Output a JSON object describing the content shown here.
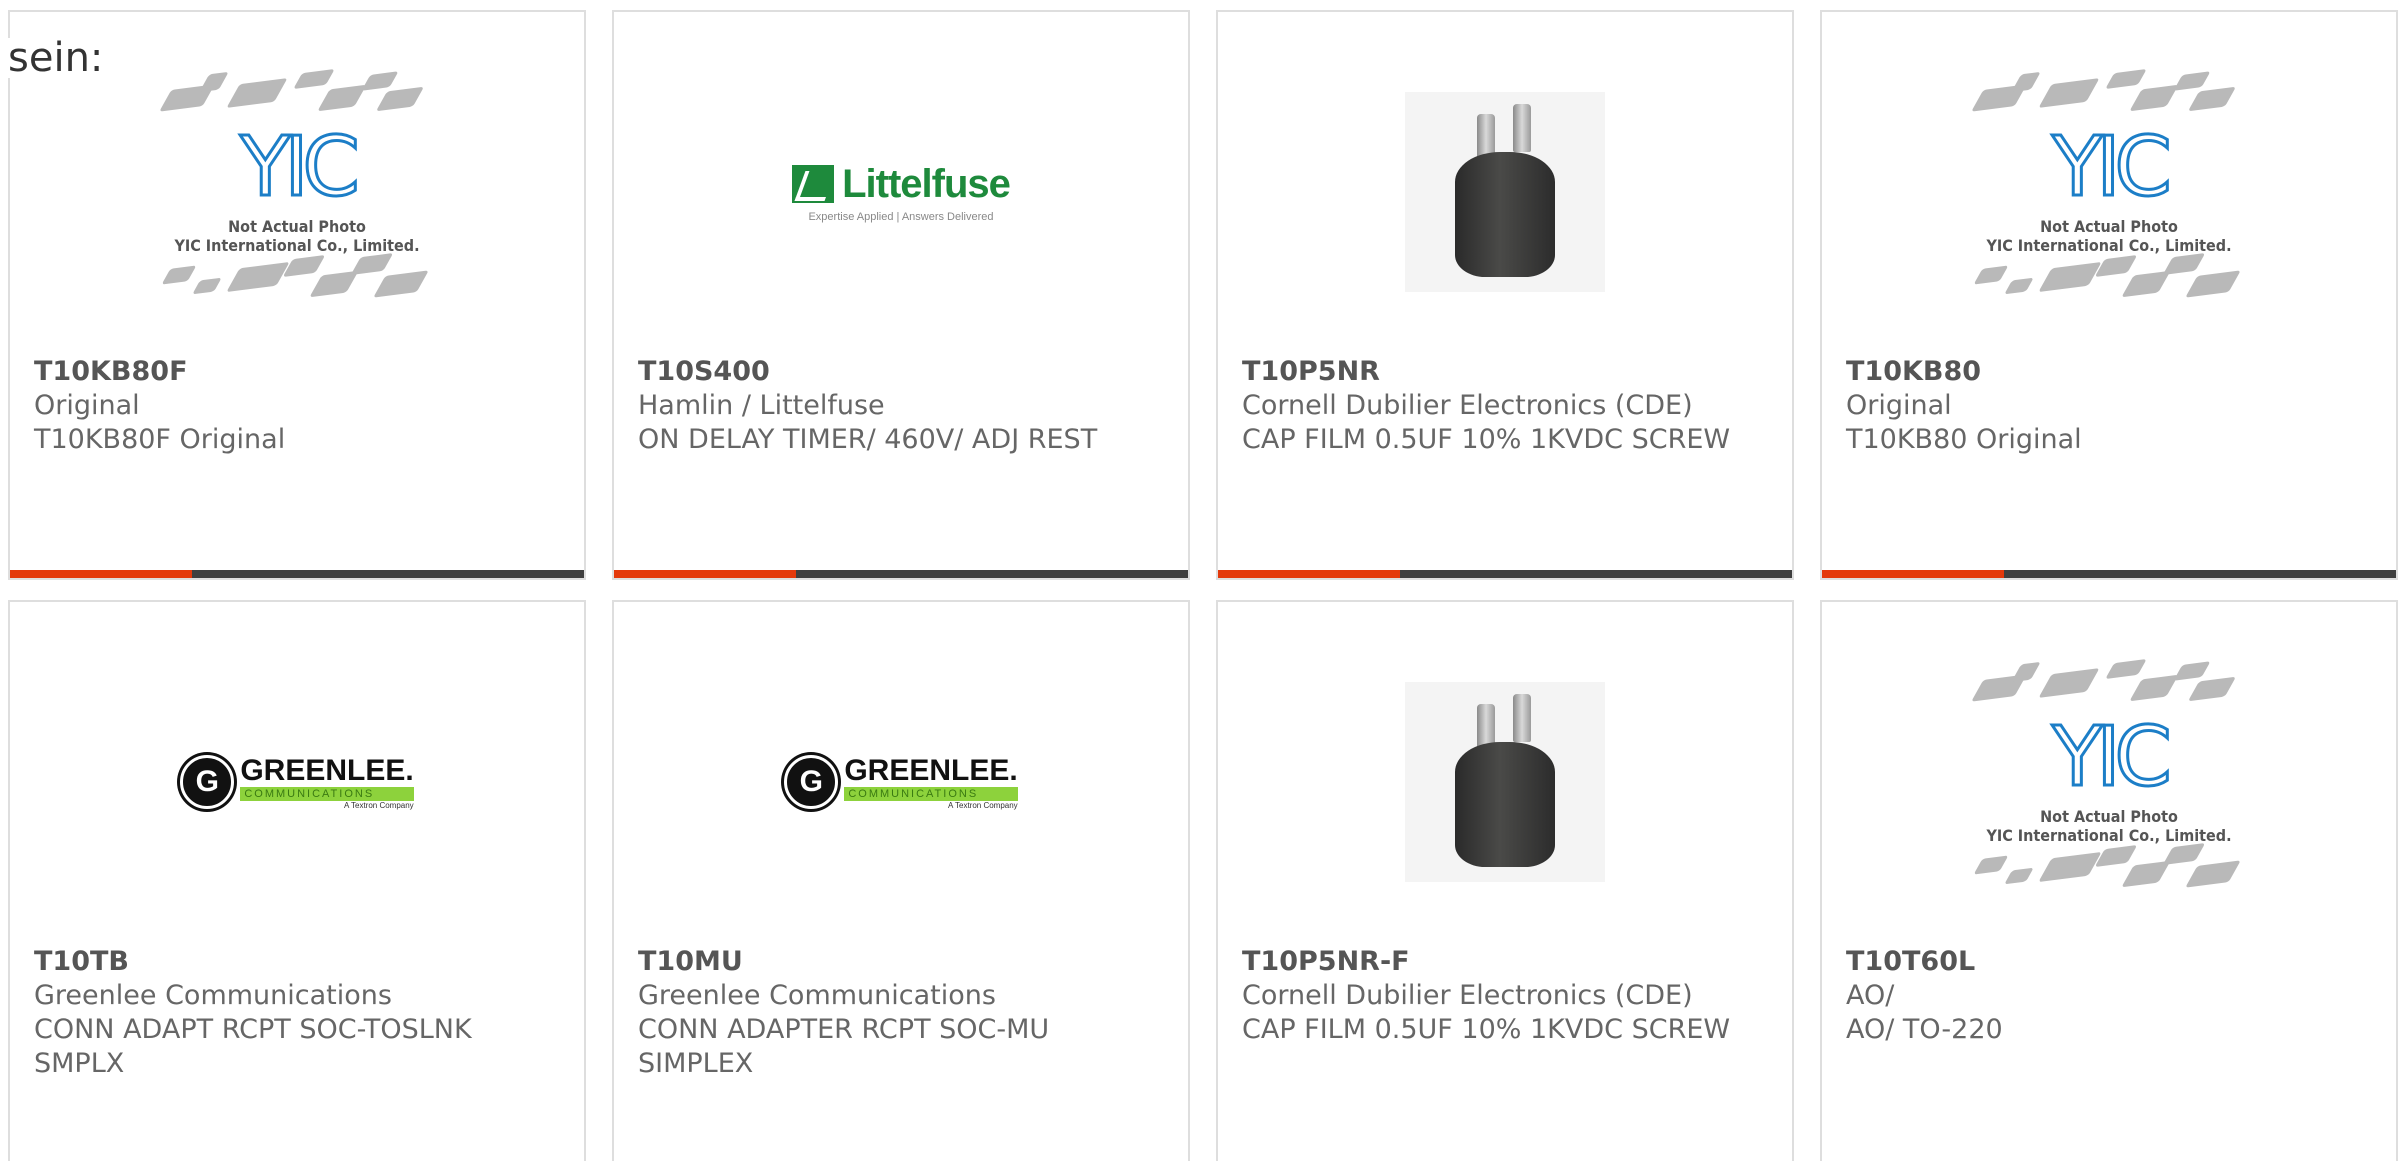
{
  "fragment_text": "sein:",
  "colors": {
    "accent": "#e4390b",
    "bar": "#3f3f3f",
    "border": "#dedede",
    "yic_blue": "#1c7ec7",
    "littelfuse_green": "#1e8a3c",
    "greenlee_green": "#8dd23c"
  },
  "placeholder": {
    "line1": "Not Actual Photo",
    "line2": "YIC International Co., Limited."
  },
  "brands": {
    "littelfuse": {
      "word": "Littelfuse",
      "tagline": "Expertise Applied | Answers Delivered"
    },
    "greenlee": {
      "letter": "G",
      "word": "GREENLEE.",
      "sub": "COMMUNICATIONS",
      "tex": "A Textron Company"
    }
  },
  "products": [
    {
      "part": "T10KB80F",
      "mfr": "Original",
      "desc": "T10KB80F Original",
      "image": "yic-placeholder"
    },
    {
      "part": "T10S400",
      "mfr": "Hamlin / Littelfuse",
      "desc": "ON DELAY TIMER/ 460V/ ADJ REST",
      "image": "littelfuse-logo"
    },
    {
      "part": "T10P5NR",
      "mfr": "Cornell Dubilier Electronics (CDE)",
      "desc": "CAP FILM 0.5UF 10% 1KVDC SCREW",
      "image": "capacitor-photo"
    },
    {
      "part": "T10KB80",
      "mfr": "Original",
      "desc": "T10KB80 Original",
      "image": "yic-placeholder"
    },
    {
      "part": "T10TB",
      "mfr": "Greenlee Communications",
      "desc": "CONN ADAPT RCPT SOC-TOSLNK SMPLX",
      "image": "greenlee-logo"
    },
    {
      "part": "T10MU",
      "mfr": "Greenlee Communications",
      "desc": "CONN ADAPTER RCPT SOC-MU SIMPLEX",
      "image": "greenlee-logo"
    },
    {
      "part": "T10P5NR-F",
      "mfr": "Cornell Dubilier Electronics (CDE)",
      "desc": "CAP FILM 0.5UF 10% 1KVDC SCREW",
      "image": "capacitor-photo"
    },
    {
      "part": "T10T60L",
      "mfr": "AO/",
      "desc": "AO/ TO-220",
      "image": "yic-placeholder"
    }
  ]
}
